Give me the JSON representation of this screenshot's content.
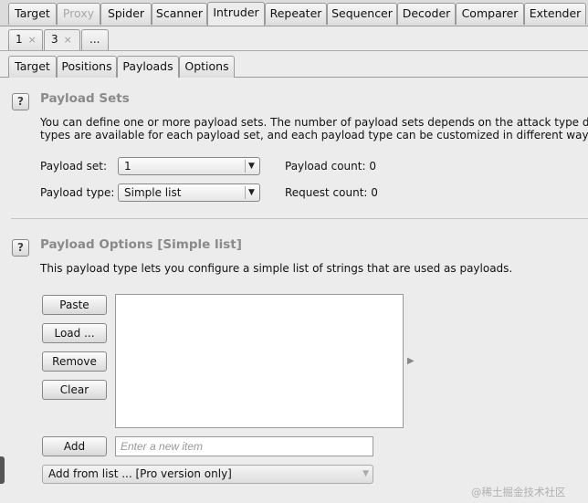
{
  "tool_tabs": [
    "Target",
    "Proxy",
    "Spider",
    "Scanner",
    "Intruder",
    "Repeater",
    "Sequencer",
    "Decoder",
    "Comparer",
    "Extender"
  ],
  "instance_tabs": [
    {
      "label": "1",
      "close": "×"
    },
    {
      "label": "3",
      "close": "×"
    },
    {
      "label": "..."
    }
  ],
  "sub_tabs": [
    "Target",
    "Positions",
    "Payloads",
    "Options"
  ],
  "payload_sets": {
    "help": "?",
    "title": "Payload Sets",
    "desc_line1": "You can define one or more payload sets. The number of payload sets depends on the attack type define",
    "desc_line2": "types are available for each payload set, and each payload type can be customized in different ways.",
    "set_label": "Payload set:",
    "set_value": "1",
    "type_label": "Payload type:",
    "type_value": "Simple list",
    "payload_count_label": "Payload count:",
    "payload_count": "0",
    "request_count_label": "Request count:",
    "request_count": "0"
  },
  "payload_options": {
    "help": "?",
    "title": "Payload Options [Simple list]",
    "desc": "This payload type lets you configure a simple list of strings that are used as payloads.",
    "buttons": {
      "paste": "Paste",
      "load": "Load ...",
      "remove": "Remove",
      "clear": "Clear",
      "add": "Add"
    },
    "new_item_placeholder": "Enter a new item",
    "add_from_list": "Add from list ... [Pro version only]"
  },
  "watermark": "@稀土掘金技术社区",
  "icons": {
    "dropdown": "▼",
    "expand": "▶"
  }
}
